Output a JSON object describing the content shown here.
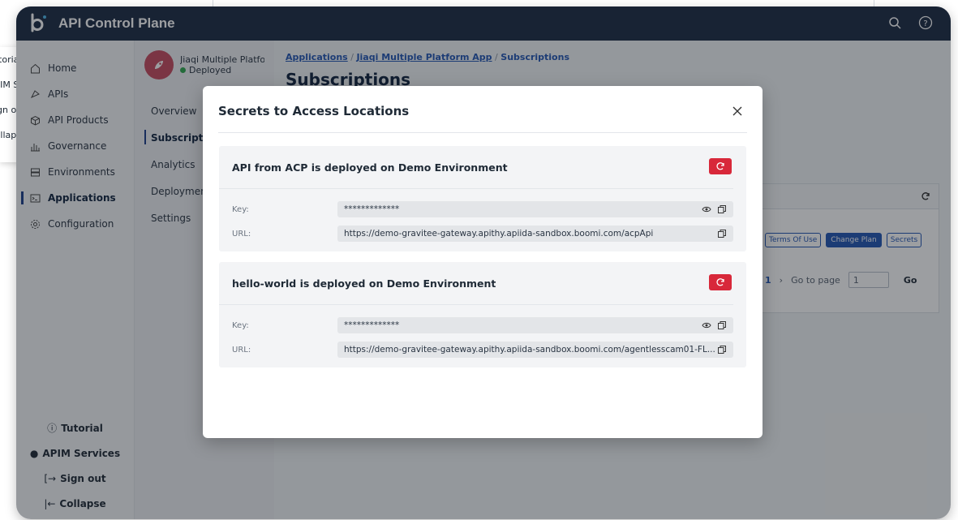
{
  "background_peek": {
    "items": [
      "Tutorial",
      "APIM Services",
      "Sign out",
      "Collapse"
    ]
  },
  "topbar": {
    "title": "API Control Plane",
    "search_icon": "search-icon",
    "help_icon": "help-icon"
  },
  "leftnav": {
    "items": [
      {
        "label": "Home",
        "icon": "home-icon"
      },
      {
        "label": "APIs",
        "icon": "apis-icon"
      },
      {
        "label": "API Products",
        "icon": "box-icon"
      },
      {
        "label": "Governance",
        "icon": "governance-icon"
      },
      {
        "label": "Environments",
        "icon": "server-icon"
      },
      {
        "label": "Applications",
        "icon": "terminal-icon",
        "active": true
      },
      {
        "label": "Configuration",
        "icon": "gear-icon"
      }
    ],
    "bottom": {
      "tutorial": "Tutorial",
      "apim": "APIM Services",
      "signout": "Sign out",
      "collapse": "Collapse"
    }
  },
  "subnav": {
    "app_name": "Jiaqi Multiple Platform App",
    "status": "Deployed",
    "items": [
      "Overview",
      "Subscriptions",
      "Analytics",
      "Deployments",
      "Settings"
    ]
  },
  "main": {
    "breadcrumb": {
      "applications": "Applications",
      "sep": "/",
      "app": "Jiaqi Multiple Platform App",
      "current": "Subscriptions"
    },
    "title": "Subscriptions",
    "buttons": {
      "terms": "Terms Of Use",
      "change_plan": "Change Plan",
      "secrets": "Secrets"
    },
    "pager": {
      "current": "1",
      "goto_label": "Go to page",
      "page_value": "1",
      "go": "Go"
    }
  },
  "modal": {
    "title": "Secrets to Access Locations",
    "cards": [
      {
        "heading": "API from ACP is deployed on Demo Environment",
        "key_label": "Key:",
        "key_value": "*************",
        "url_label": "URL:",
        "url_value": "https://demo-gravitee-gateway.apithy.apiida-sandbox.boomi.com/acpApi"
      },
      {
        "heading": "hello-world is deployed on Demo Environment",
        "key_label": "Key:",
        "key_value": "*************",
        "url_label": "URL:",
        "url_value": "https://demo-gravitee-gateway.apithy.apiida-sandbox.boomi.com/agentlesscam01-FL..."
      }
    ]
  },
  "colors": {
    "topbar": "#1d2b44",
    "accent": "#2456b4",
    "danger": "#d8283a",
    "status_ok": "#2fa84f"
  }
}
